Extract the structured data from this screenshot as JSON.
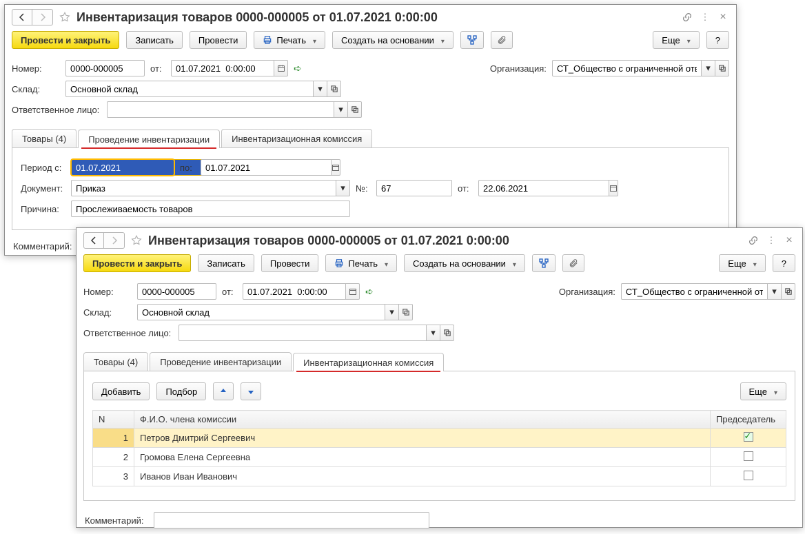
{
  "window_a": {
    "title": "Инвентаризация товаров 0000-000005 от 01.07.2021 0:00:00",
    "toolbar": {
      "post_and_close": "Провести и закрыть",
      "save": "Записать",
      "post": "Провести",
      "print": "Печать",
      "create_based_on": "Создать на основании",
      "more": "Еще",
      "help": "?"
    },
    "fields": {
      "number_label": "Номер:",
      "number_value": "0000-000005",
      "from_label": "от:",
      "from_value": "01.07.2021  0:00:00",
      "org_label": "Организация:",
      "org_value": "СТ_Общество с ограниченной ответственностью \"Конкорд\"",
      "warehouse_label": "Склад:",
      "warehouse_value": "Основной склад",
      "responsible_label": "Ответственное лицо:",
      "responsible_value": ""
    },
    "tabs": [
      "Товары (4)",
      "Проведение инвентаризации",
      "Инвентаризационная комиссия"
    ],
    "active_tab_index": 1,
    "body": {
      "period_from_label": "Период с:",
      "period_from_value": "01.07.2021",
      "period_to_label": "по:",
      "period_to_value": "01.07.2021",
      "doc_label": "Документ:",
      "doc_value": "Приказ",
      "doc_num_label": "№:",
      "doc_num_value": "67",
      "doc_from_label": "от:",
      "doc_from_value": "22.06.2021",
      "reason_label": "Причина:",
      "reason_value": "Прослеживаемость товаров"
    },
    "comment_label": "Комментарий:"
  },
  "window_b": {
    "title": "Инвентаризация товаров 0000-000005 от 01.07.2021 0:00:00",
    "toolbar": {
      "post_and_close": "Провести и закрыть",
      "save": "Записать",
      "post": "Провести",
      "print": "Печать",
      "create_based_on": "Создать на основании",
      "more": "Еще",
      "help": "?"
    },
    "fields": {
      "number_label": "Номер:",
      "number_value": "0000-000005",
      "from_label": "от:",
      "from_value": "01.07.2021  0:00:00",
      "org_label": "Организация:",
      "org_value": "СТ_Общество с ограниченной ответственностью \"Конкорд\"",
      "warehouse_label": "Склад:",
      "warehouse_value": "Основной склад",
      "responsible_label": "Ответственное лицо:",
      "responsible_value": ""
    },
    "tabs": [
      "Товары (4)",
      "Проведение инвентаризации",
      "Инвентаризационная комиссия"
    ],
    "active_tab_index": 2,
    "commission": {
      "add_btn": "Добавить",
      "select_btn": "Подбор",
      "more_btn": "Еще",
      "col_n": "N",
      "col_fio": "Ф.И.О. члена комиссии",
      "col_chair": "Председатель",
      "rows": [
        {
          "n": "1",
          "fio": "Петров Дмитрий Сергеевич",
          "chair": true
        },
        {
          "n": "2",
          "fio": "Громова Елена Сергеевна",
          "chair": false
        },
        {
          "n": "3",
          "fio": "Иванов Иван Иванович",
          "chair": false
        }
      ]
    },
    "comment_label": "Комментарий:",
    "comment_value": ""
  }
}
